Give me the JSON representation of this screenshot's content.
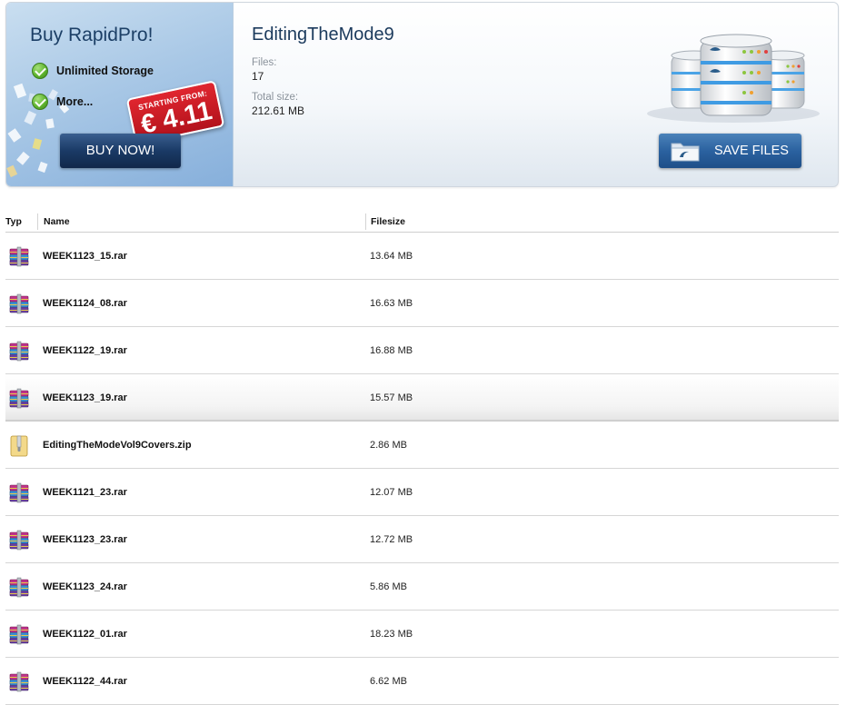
{
  "promo": {
    "title": "Buy RapidPro!",
    "features": [
      "Unlimited Storage",
      "More..."
    ],
    "price_prefix": "STARTING FROM:",
    "price": "€ 4.11",
    "buy_button": "BUY NOW!"
  },
  "folder": {
    "title": "EditingTheMode9",
    "files_label": "Files:",
    "files_value": "17",
    "size_label": "Total size:",
    "size_value": "212.61 MB",
    "save_button": "SAVE FILES"
  },
  "table": {
    "headers": {
      "type": "Typ",
      "name": "Name",
      "size": "Filesize"
    },
    "rows": [
      {
        "type": "rar",
        "name": "WEEK1123_15.rar",
        "size": "13.64 MB"
      },
      {
        "type": "rar",
        "name": "WEEK1124_08.rar",
        "size": "16.63 MB"
      },
      {
        "type": "rar",
        "name": "WEEK1122_19.rar",
        "size": "16.88 MB"
      },
      {
        "type": "rar",
        "name": "WEEK1123_19.rar",
        "size": "15.57 MB"
      },
      {
        "type": "zip",
        "name": "EditingTheModeVol9Covers.zip",
        "size": "2.86 MB"
      },
      {
        "type": "rar",
        "name": "WEEK1121_23.rar",
        "size": "12.07 MB"
      },
      {
        "type": "rar",
        "name": "WEEK1123_23.rar",
        "size": "12.72 MB"
      },
      {
        "type": "rar",
        "name": "WEEK1123_24.rar",
        "size": "5.86 MB"
      },
      {
        "type": "rar",
        "name": "WEEK1122_01.rar",
        "size": "18.23 MB"
      },
      {
        "type": "rar",
        "name": "WEEK1122_44.rar",
        "size": "6.62 MB"
      }
    ]
  },
  "icons": {
    "rar": "winrar-archive-icon",
    "zip": "zip-folder-icon",
    "check": "green-checkmark-icon",
    "servers": "server-stack-icon",
    "save": "folder-icon"
  },
  "colors": {
    "promo_bg": "#a9c8e6",
    "price_tag": "#c8161f",
    "buy_button": "#1a3a66",
    "save_button": "#2b62a0",
    "title": "#1b3a5c",
    "check": "#5fb52f"
  }
}
